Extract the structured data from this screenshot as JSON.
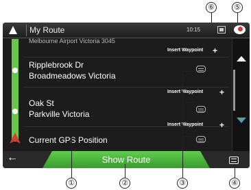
{
  "header": {
    "title": "My Route",
    "time": "10:15",
    "message_count": "1"
  },
  "route": {
    "partial_top": "Melbourne Airport Victoria 3045",
    "insert_label": "Insert Waypoint",
    "waypoints": [
      {
        "line1": "Ripplebrook Dr",
        "line2": "Broadmeadows Victoria"
      },
      {
        "line1": "Oak St",
        "line2": "Parkville Victoria"
      }
    ],
    "start": "Current GPS Position"
  },
  "footer": {
    "show_route": "Show Route"
  },
  "callouts": [
    "①",
    "②",
    "③",
    "④",
    "⑤",
    "⑥"
  ],
  "colors": {
    "route_green": "#6ac44a",
    "start_marker_red": "#d63b2f",
    "button_green": "#4db53c"
  }
}
